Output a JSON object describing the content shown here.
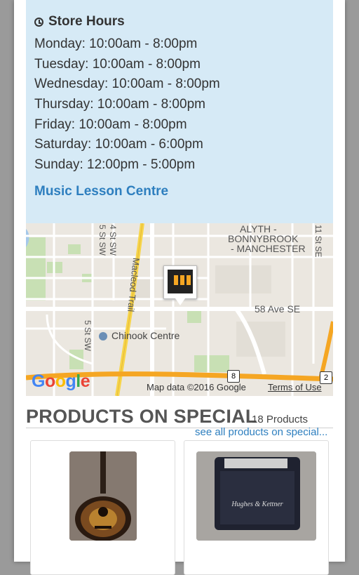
{
  "store_hours": {
    "title": "Store Hours",
    "days": [
      "Monday: 10:00am - 8:00pm",
      "Tuesday: 10:00am - 8:00pm",
      "Wednesday: 10:00am - 8:00pm",
      "Thursday: 10:00am - 8:00pm",
      "Friday: 10:00am - 8:00pm",
      "Saturday: 10:00am - 6:00pm",
      "Sunday: 12:00pm - 5:00pm"
    ],
    "lesson_link": "Music Lesson Centre"
  },
  "map": {
    "labels": {
      "neighborhood_1": "ALYTH -",
      "neighborhood_2": "BONNYBROOK",
      "neighborhood_3": "- MANCHESTER",
      "macleod_trail": "Macleod Trail",
      "ave_58": "58 Ave SE",
      "chinook": "Chinook Centre",
      "st_4": "4 St SW",
      "st_5_top": "5 St SW",
      "st_5_bottom": "5 St SW",
      "st_11": "11 St SE",
      "route_8": "8",
      "route_2": "2"
    },
    "google_logo": "Google",
    "map_data": "Map data ©2016 Google",
    "terms": "Terms of Use"
  },
  "products": {
    "title": "PRODUCTS ON SPECIAL",
    "count": "18 Products",
    "see_all": "see all products on special..."
  },
  "colors": {
    "accent": "#2e7fbf",
    "panel_bg": "#d6eaf6",
    "road_orange": "#f5a623",
    "road_yellow": "#f7d54a"
  }
}
